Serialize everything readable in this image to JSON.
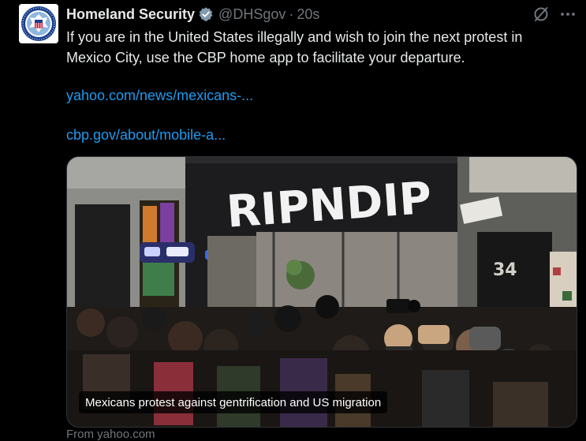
{
  "tweet": {
    "display_name": "Homeland Security",
    "handle": "@DHSgov",
    "separator": "·",
    "time": "20s",
    "text": "If you are in the United States illegally and wish to join the next protest in Mexico City, use the CBP home app to facilitate your departure.",
    "links": [
      "yahoo.com/news/mexicans-...",
      "cbp.gov/about/mobile-a..."
    ],
    "media": {
      "caption": "Mexicans protest against gentrification and US migration",
      "storefront_sign": "RIPNDIP",
      "building_number": "34"
    },
    "source": "From yahoo.com"
  },
  "icons": {
    "avatar": "dhs-seal-icon",
    "verified": "verified-badge-icon",
    "grok": "grok-icon",
    "more": "more-options-icon"
  },
  "colors": {
    "background": "#000000",
    "text_primary": "#e7e9ea",
    "text_secondary": "#71767b",
    "link": "#1d9bf0",
    "verified_gold": "#e2b719"
  }
}
